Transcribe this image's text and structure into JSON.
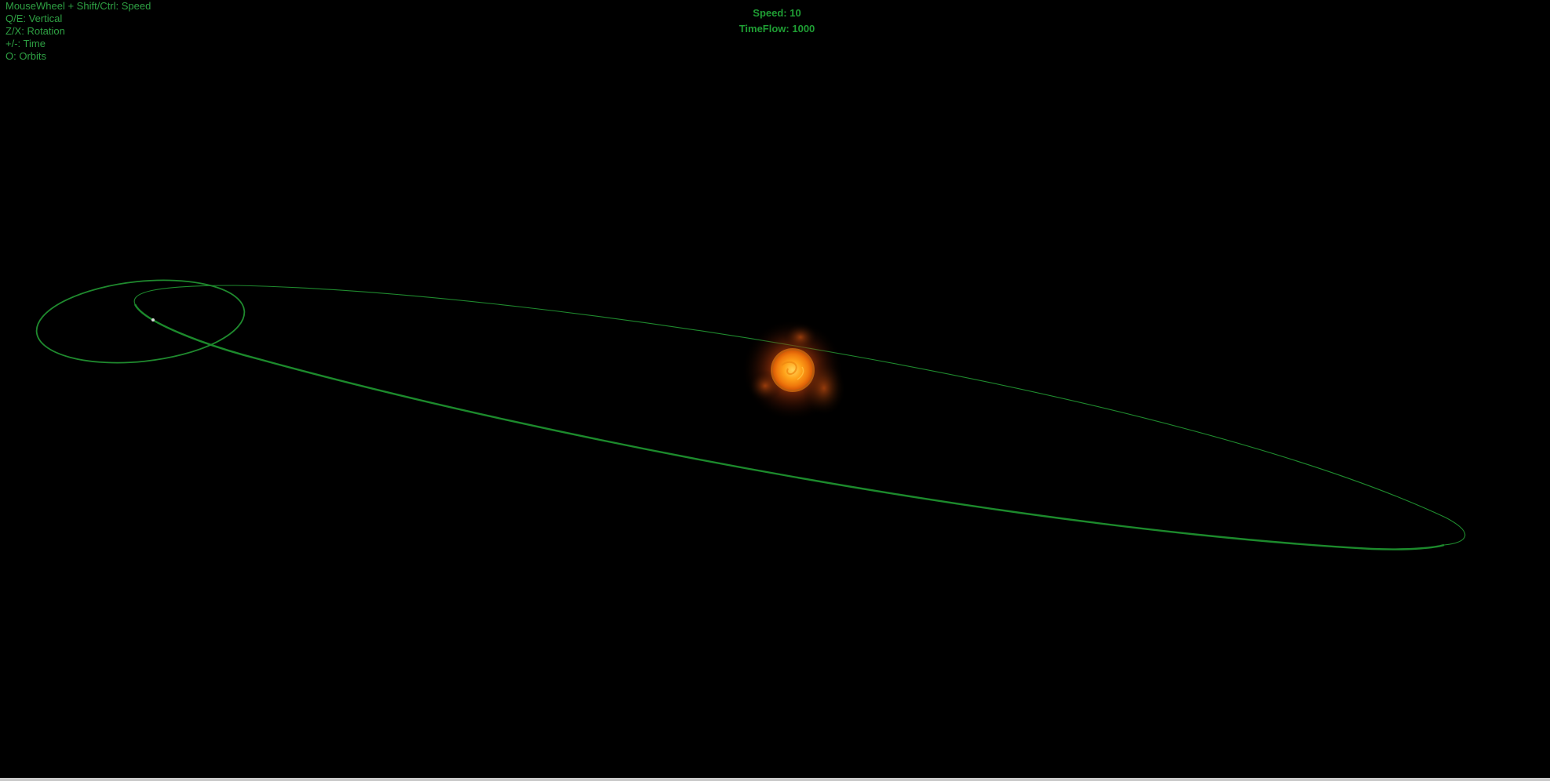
{
  "hud": {
    "controls": [
      "MouseWheel + Shift/Ctrl: Speed",
      "Q/E: Vertical",
      "Z/X: Rotation",
      "+/-: Time",
      "O: Orbits"
    ],
    "speed_label": "Speed: 10",
    "timeflow_label": "TimeFlow: 1000"
  },
  "colors": {
    "background": "#000000",
    "hud_text": "#2ea043",
    "status_text": "#1f9e34",
    "orbit_line": "#1f8a2e",
    "sun_core": "#ffae1a",
    "sun_corona": "#a8300a"
  },
  "scene": {
    "objects": [
      "sun",
      "planet",
      "large-orbit",
      "small-orbit"
    ]
  }
}
